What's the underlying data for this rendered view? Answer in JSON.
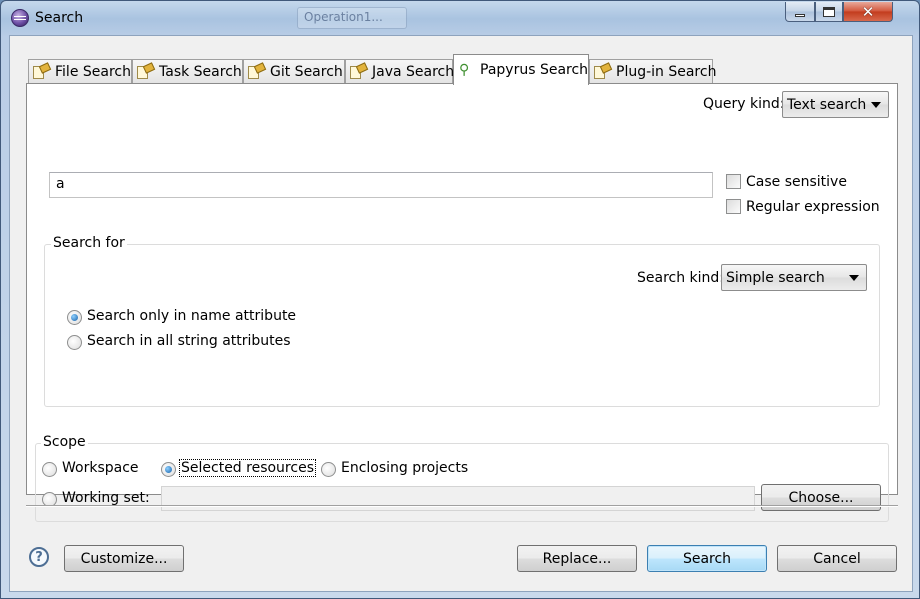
{
  "window": {
    "title": "Search",
    "background_task_label": "Operation1...",
    "close_glyph": "✕"
  },
  "tabs": [
    {
      "label": "File Search",
      "active": false
    },
    {
      "label": "Task Search",
      "active": false
    },
    {
      "label": "Git Search",
      "active": false
    },
    {
      "label": "Java Search",
      "active": false
    },
    {
      "label": "Papyrus Search",
      "active": true
    },
    {
      "label": "Plug-in Search",
      "active": false
    }
  ],
  "query": {
    "kind_label": "Query kind:",
    "kind_value": "Text search",
    "text_value": "a",
    "case_sensitive_label": "Case sensitive",
    "case_sensitive_checked": false,
    "regex_label": "Regular expression",
    "regex_checked": false
  },
  "search_for": {
    "group_title": "Search for",
    "kind_label": "Search kind:",
    "kind_value": "Simple search",
    "option_name_only": "Search only in name attribute",
    "option_all_strings": "Search in all string attributes",
    "selected": "name_only"
  },
  "scope": {
    "group_title": "Scope",
    "workspace_label": "Workspace",
    "selected_resources_label": "Selected resources",
    "enclosing_projects_label": "Enclosing projects",
    "working_set_label": "Working set:",
    "working_set_value": "",
    "choose_label": "Choose...",
    "selected": "selected_resources"
  },
  "footer": {
    "help_glyph": "?",
    "customize_label": "Customize...",
    "replace_label": "Replace...",
    "search_label": "Search",
    "cancel_label": "Cancel"
  },
  "colors": {
    "accent": "#3c7fb1",
    "window_frame": "#a9c3e0",
    "dialog_bg": "#f0f0f0"
  }
}
